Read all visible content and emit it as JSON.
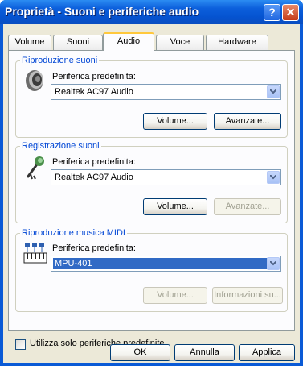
{
  "window": {
    "title": "Proprietà - Suoni e periferiche audio",
    "help": "?",
    "close": "✕"
  },
  "tabs": [
    {
      "label": "Volume"
    },
    {
      "label": "Suoni"
    },
    {
      "label": "Audio"
    },
    {
      "label": "Voce"
    },
    {
      "label": "Hardware"
    }
  ],
  "playback": {
    "group_label": "Riproduzione suoni",
    "field_label": "Periferica predefinita:",
    "device": "Realtek AC97 Audio",
    "btn_volume": "Volume...",
    "btn_advanced": "Avanzate..."
  },
  "recording": {
    "group_label": "Registrazione suoni",
    "field_label": "Periferica predefinita:",
    "device": "Realtek AC97 Audio",
    "btn_volume": "Volume...",
    "btn_advanced": "Avanzate..."
  },
  "midi": {
    "group_label": "Riproduzione musica MIDI",
    "field_label": "Periferica predefinita:",
    "device": "MPU-401",
    "btn_volume": "Volume...",
    "btn_info": "Informazioni su..."
  },
  "option": {
    "label": "Utilizza solo periferiche predefinite"
  },
  "footer": {
    "ok": "OK",
    "cancel": "Annulla",
    "apply": "Applica"
  }
}
